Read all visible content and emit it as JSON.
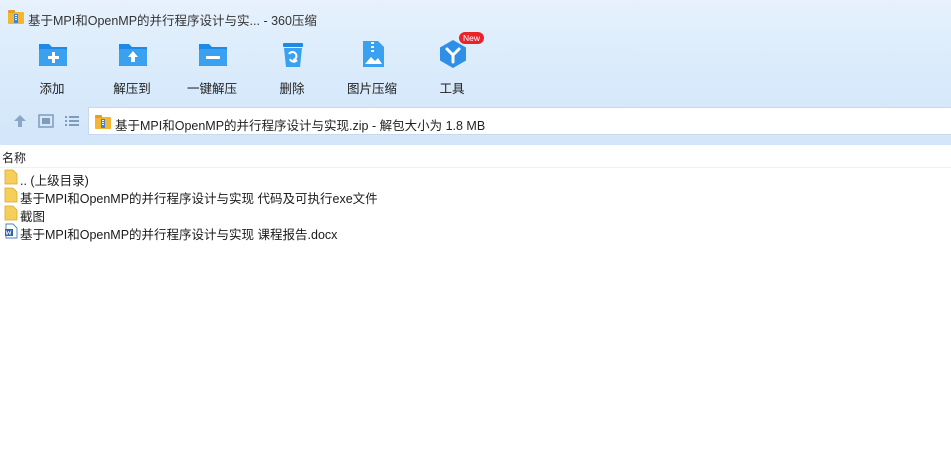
{
  "window": {
    "title": "基于MPI和OpenMP的并行程序设计与实...  - 360压缩"
  },
  "toolbar": {
    "items": [
      {
        "label": "添加",
        "icon": "add-folder-icon"
      },
      {
        "label": "解压到",
        "icon": "extract-to-icon"
      },
      {
        "label": "一键解压",
        "icon": "one-click-extract-icon"
      },
      {
        "label": "删除",
        "icon": "trash-icon"
      },
      {
        "label": "图片压缩",
        "icon": "image-compress-icon"
      },
      {
        "label": "工具",
        "icon": "tools-icon",
        "badge": "New"
      }
    ]
  },
  "navbar": {
    "path": "基于MPI和OpenMP的并行程序设计与实现.zip - 解包大小为 1.8 MB"
  },
  "list": {
    "column_name": "名称",
    "rows": [
      {
        "name": ".. (上级目录)",
        "type": "folder"
      },
      {
        "name": "基于MPI和OpenMP的并行程序设计与实现 代码及可执行exe文件",
        "type": "folder"
      },
      {
        "name": "截图",
        "type": "folder"
      },
      {
        "name": "基于MPI和OpenMP的并行程序设计与实现 课程报告.docx",
        "type": "docx"
      }
    ]
  },
  "colors": {
    "accent": "#2f8fe6",
    "chrome_bg": "#d8eafb",
    "badge": "#e8242b",
    "folder": "#f6cf5b"
  }
}
